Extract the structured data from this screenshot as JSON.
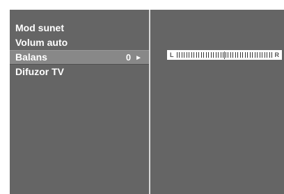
{
  "menu": {
    "items": [
      {
        "label": "Mod sunet"
      },
      {
        "label": "Volum auto"
      },
      {
        "label": "Balans",
        "value": "0",
        "selected": true
      },
      {
        "label": "Difuzor TV"
      }
    ],
    "arrow_icon": "►"
  },
  "balance": {
    "left_label": "L",
    "right_label": "R",
    "value": 0,
    "min": -50,
    "max": 50
  },
  "colors": {
    "panel": "#656565",
    "selected_row": "#888888",
    "text": "#ffffff"
  }
}
